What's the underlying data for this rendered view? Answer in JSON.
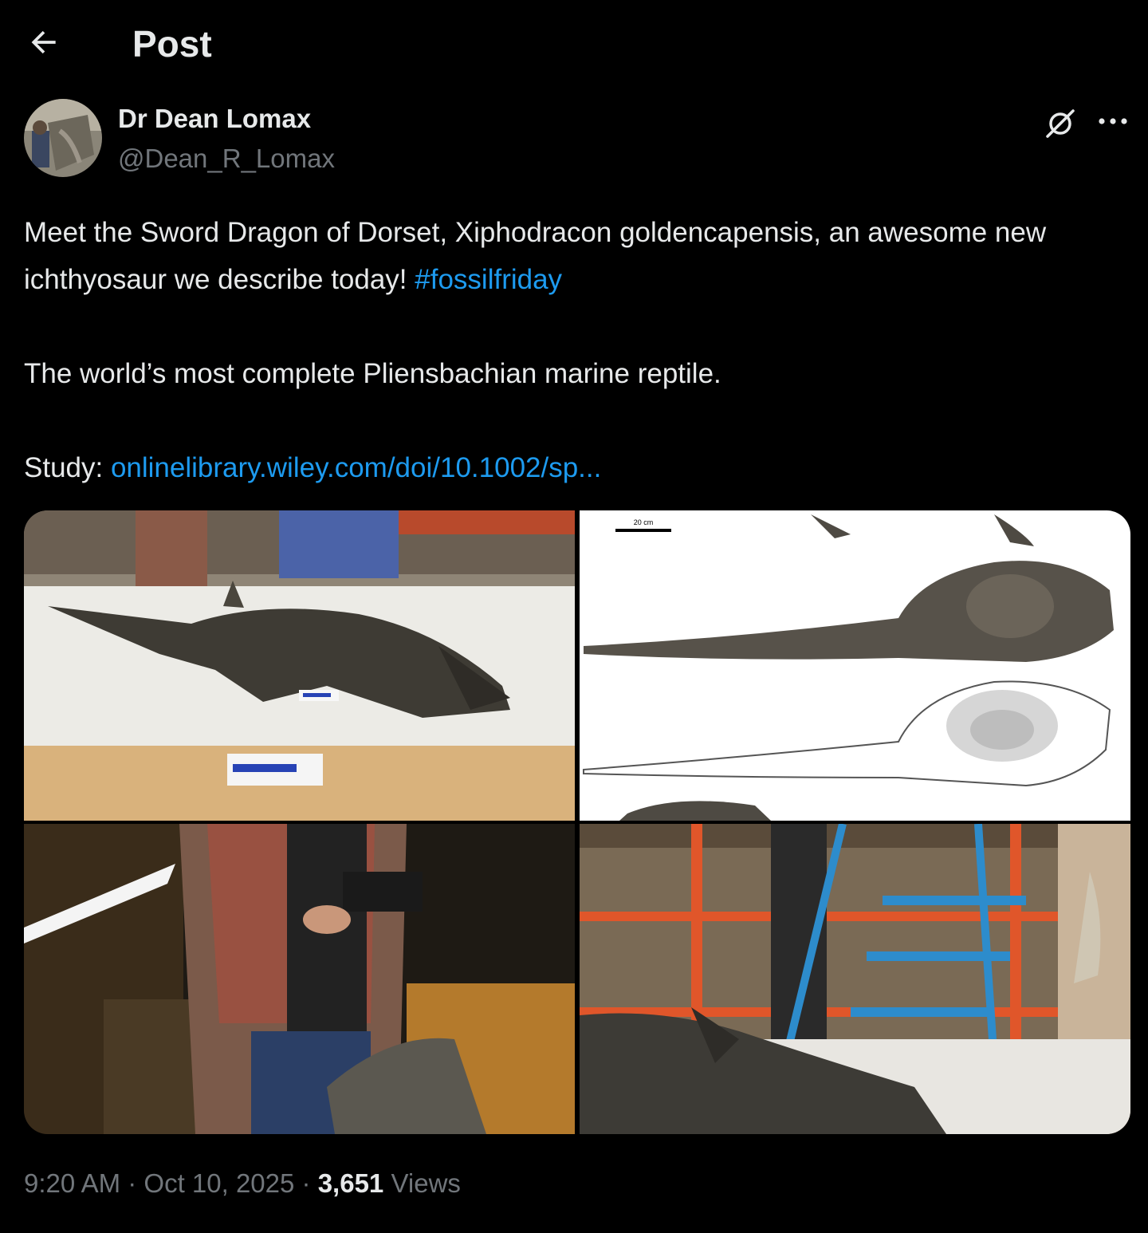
{
  "header": {
    "title": "Post",
    "back_icon": "arrow-left-icon"
  },
  "author": {
    "name": "Dr Dean Lomax",
    "handle": "@Dean_R_Lomax",
    "avatar_icon": "avatar"
  },
  "actions": {
    "grok_icon": "grok-icon",
    "more_icon": "more-horizontal-icon"
  },
  "post": {
    "line1_text": "Meet the Sword Dragon of Dorset, Xiphodracon goldencapensis, an awesome new ichthyosaur we describe today! ",
    "hashtag": "#fossilfriday",
    "line2_text": "The world’s most complete Pliensbachian marine reptile.",
    "study_label": "Study: ",
    "study_link": "onlinelibrary.wiley.com/doi/10.1002/sp..."
  },
  "media": {
    "scale_label": "20 cm"
  },
  "meta": {
    "time": "9:20 AM",
    "sep1": " · ",
    "date": "Oct 10, 2025",
    "sep2": " · ",
    "views_count": "3,651",
    "views_label": " Views"
  },
  "colors": {
    "background": "#000000",
    "text": "#e7e9ea",
    "muted": "#71767b",
    "link": "#1d9bf0"
  }
}
